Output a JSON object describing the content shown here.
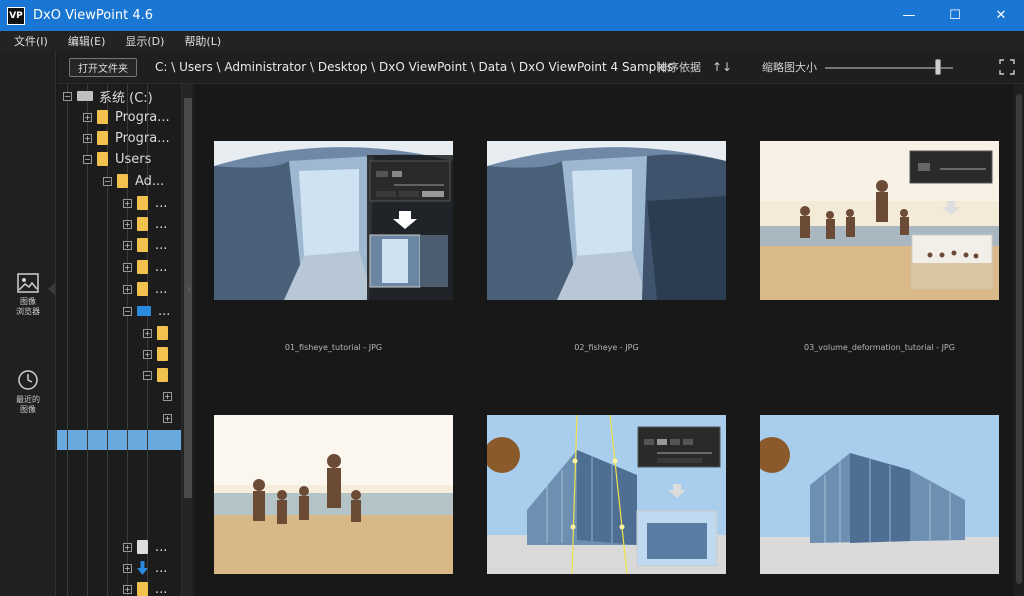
{
  "app": {
    "logo_text": "VP",
    "title": "DxO ViewPoint 4.6"
  },
  "window_controls": {
    "minimize": "—",
    "maximize": "☐",
    "close": "✕"
  },
  "menu": [
    {
      "label": "文件(I)"
    },
    {
      "label": "编辑(E)"
    },
    {
      "label": "显示(D)"
    },
    {
      "label": "帮助(L)"
    }
  ],
  "rail": {
    "browser_label_1": "图像",
    "browser_label_2": "浏览器",
    "recent_label_1": "最近的",
    "recent_label_2": "图像"
  },
  "toolbar": {
    "open_folder": "打开文件夹",
    "path": "C: \\ Users \\ Administrator \\ Desktop \\ DxO ViewPoint \\ Data \\ DxO ViewPoint 4 Samples",
    "sort_label": "排序依据",
    "sort_icon": "↑↓",
    "thumb_size_label": "缩略图大小",
    "thumb_size_value": 0.88
  },
  "tree": {
    "items": [
      {
        "label": "系统 (C:)",
        "expander": "−"
      },
      {
        "label": "Progra...",
        "expander": "+"
      },
      {
        "label": "Progra...",
        "expander": "+"
      },
      {
        "label": "Users",
        "expander": "−"
      },
      {
        "label": "Ad...",
        "expander": "−"
      },
      {
        "label": "...",
        "expander": "+"
      },
      {
        "label": "...",
        "expander": "+"
      },
      {
        "label": "...",
        "expander": "+"
      },
      {
        "label": "...",
        "expander": "+"
      },
      {
        "label": "...",
        "expander": "+"
      },
      {
        "label": "...",
        "expander": "−"
      },
      {
        "label": "",
        "expander": "+"
      },
      {
        "label": "",
        "expander": "+"
      },
      {
        "label": "",
        "expander": "−"
      },
      {
        "label": "",
        "expander": "+"
      },
      {
        "label": "",
        "expander": "+"
      },
      {
        "label": "...",
        "expander": "+"
      },
      {
        "label": "...",
        "expander": "+"
      },
      {
        "label": "...",
        "expander": "+"
      }
    ],
    "scroll_dots": "⋮"
  },
  "thumbnails": [
    {
      "label": "01_fisheye_tutorial - JPG"
    },
    {
      "label": "02_fisheye - JPG"
    },
    {
      "label": "03_volume_deformation_tutorial - JPG"
    },
    {
      "label": ""
    },
    {
      "label": ""
    },
    {
      "label": ""
    }
  ],
  "colors": {
    "titlebar": "#1976d2",
    "selection": "#6aa9dd",
    "folder": "#f1c24d"
  }
}
